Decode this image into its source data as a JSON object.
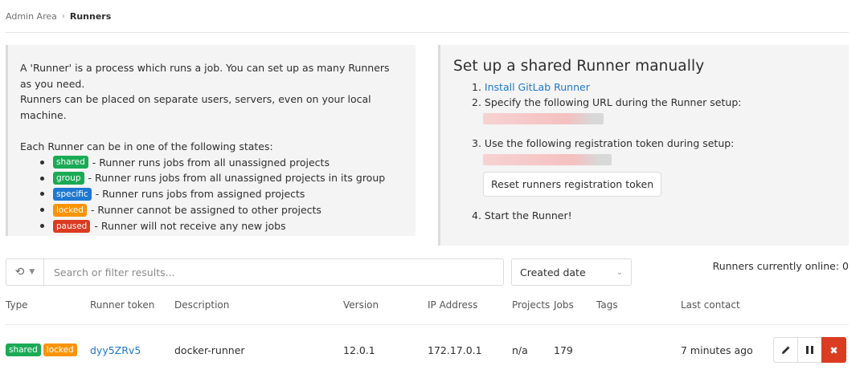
{
  "breadcrumb": {
    "parent": "Admin Area",
    "separator": "›",
    "current": "Runners"
  },
  "info": {
    "line1": "A 'Runner' is a process which runs a job. You can set up as many Runners as you need.",
    "line2": "Runners can be placed on separate users, servers, even on your local machine.",
    "states_intro": "Each Runner can be in one of the following states:",
    "states": [
      {
        "badge": "shared",
        "color": "#1aaa55",
        "text": "- Runner runs jobs from all unassigned projects"
      },
      {
        "badge": "group",
        "color": "#1aaa55",
        "text": "- Runner runs jobs from all unassigned projects in its group"
      },
      {
        "badge": "specific",
        "color": "#1f78d1",
        "text": "- Runner runs jobs from assigned projects"
      },
      {
        "badge": "locked",
        "color": "#fc9403",
        "text": "- Runner cannot be assigned to other projects"
      },
      {
        "badge": "paused",
        "color": "#db3b21",
        "text": "- Runner will not receive any new jobs"
      }
    ]
  },
  "setup": {
    "title": "Set up a shared Runner manually",
    "steps": [
      {
        "num": "1.",
        "link": "Install GitLab Runner"
      },
      {
        "num": "2.",
        "text": "Specify the following URL during the Runner setup:"
      },
      {
        "num": "3.",
        "text": "Use the following registration token during setup:"
      },
      {
        "num": "4.",
        "text": "Start the Runner!"
      }
    ],
    "reset_button": "Reset runners registration token"
  },
  "filter": {
    "history_icon": "history-icon",
    "search_placeholder": "Search or filter results...",
    "sort_label": "Created date",
    "online": "Runners currently online: 0"
  },
  "table": {
    "headers": [
      "Type",
      "Runner token",
      "Description",
      "Version",
      "IP Address",
      "Projects",
      "Jobs",
      "Tags",
      "Last contact"
    ],
    "rows": [
      {
        "type_badges": [
          {
            "label": "shared",
            "color": "#1aaa55"
          },
          {
            "label": "locked",
            "color": "#fc9403"
          }
        ],
        "token": "dyy5ZRv5",
        "description": "docker-runner",
        "version": "12.0.1",
        "ip": "172.17.0.1",
        "projects": "n/a",
        "jobs": "179",
        "tags": "",
        "last_contact": "7 minutes ago",
        "actions": {
          "edit_icon": "pencil-icon",
          "pause_icon": "pause-icon",
          "remove_icon": "close-icon",
          "remove_glyph": "✖"
        }
      }
    ]
  }
}
